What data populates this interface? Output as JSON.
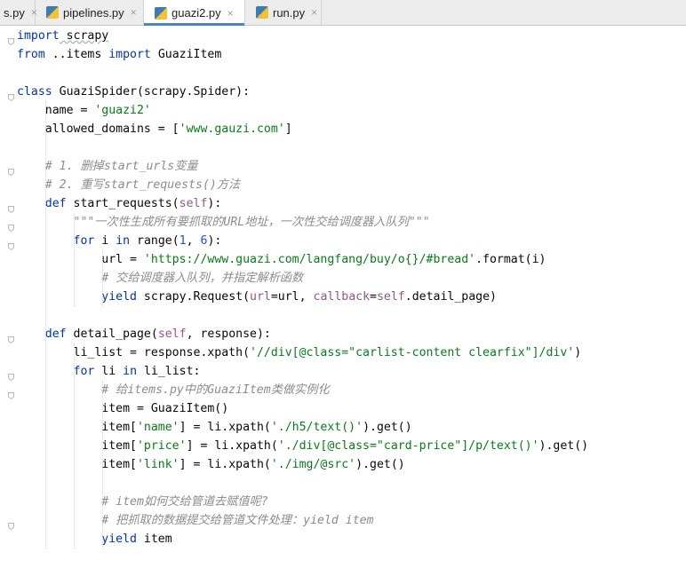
{
  "tabs": [
    {
      "label": "s.py",
      "active": false
    },
    {
      "label": "pipelines.py",
      "active": false
    },
    {
      "label": "guazi2.py",
      "active": true
    },
    {
      "label": "run.py",
      "active": false
    }
  ],
  "tab_close_glyph": "×",
  "code": [
    [
      {
        "t": "import",
        "c": "kw"
      },
      {
        "t": " scrapy"
      }
    ],
    [
      {
        "t": "from",
        "c": "kw"
      },
      {
        "t": " ..items "
      },
      {
        "t": "import",
        "c": "kw"
      },
      {
        "t": " GuaziItem"
      }
    ],
    [],
    [
      {
        "t": "class",
        "c": "kw"
      },
      {
        "t": " GuaziSpider(scrapy.Spider):"
      }
    ],
    [
      {
        "t": "    name = "
      },
      {
        "t": "'guazi2'",
        "c": "str"
      }
    ],
    [
      {
        "t": "    allowed_domains = ["
      },
      {
        "t": "'www.gauzi.com'",
        "c": "str"
      },
      {
        "t": "]"
      }
    ],
    [],
    [
      {
        "t": "    # 1. 删掉start_urls变量",
        "c": "cmt"
      }
    ],
    [
      {
        "t": "    # 2. 重写start_requests()方法",
        "c": "cmt"
      }
    ],
    [
      {
        "t": "    "
      },
      {
        "t": "def",
        "c": "kw"
      },
      {
        "t": " start_requests("
      },
      {
        "t": "self",
        "c": "slf"
      },
      {
        "t": "):"
      }
    ],
    [
      {
        "t": "        \"\"\"一次性生成所有要抓取的URL地址，一次性交给调度器入队列\"\"\"",
        "c": "cmt"
      }
    ],
    [
      {
        "t": "        "
      },
      {
        "t": "for",
        "c": "kw"
      },
      {
        "t": " i "
      },
      {
        "t": "in",
        "c": "kw"
      },
      {
        "t": " range("
      },
      {
        "t": "1",
        "c": "num"
      },
      {
        "t": ", "
      },
      {
        "t": "6",
        "c": "num"
      },
      {
        "t": "):"
      }
    ],
    [
      {
        "t": "            url = "
      },
      {
        "t": "'https://www.guazi.com/langfang/buy/o{}/#bread'",
        "c": "str"
      },
      {
        "t": ".format(i)"
      }
    ],
    [
      {
        "t": "            # 交给调度器入队列，并指定解析函数",
        "c": "cmt"
      }
    ],
    [
      {
        "t": "            "
      },
      {
        "t": "yield",
        "c": "kw"
      },
      {
        "t": " scrapy.Request("
      },
      {
        "t": "url",
        "c": "slf"
      },
      {
        "t": "=url, "
      },
      {
        "t": "callback",
        "c": "slf"
      },
      {
        "t": "="
      },
      {
        "t": "self",
        "c": "slf"
      },
      {
        "t": ".detail_page)"
      }
    ],
    [],
    [
      {
        "t": "    "
      },
      {
        "t": "def",
        "c": "kw"
      },
      {
        "t": " detail_page("
      },
      {
        "t": "self",
        "c": "slf"
      },
      {
        "t": ", response):"
      }
    ],
    [
      {
        "t": "        li_list = response.xpath("
      },
      {
        "t": "'//div[@class=\"carlist-content clearfix\"]/div'",
        "c": "str"
      },
      {
        "t": ")"
      }
    ],
    [
      {
        "t": "        "
      },
      {
        "t": "for",
        "c": "kw"
      },
      {
        "t": " li "
      },
      {
        "t": "in",
        "c": "kw"
      },
      {
        "t": " li_list:"
      }
    ],
    [
      {
        "t": "            # 给items.py中的GuaziItem类做实例化",
        "c": "cmt"
      }
    ],
    [
      {
        "t": "            item = GuaziItem()"
      }
    ],
    [
      {
        "t": "            item["
      },
      {
        "t": "'name'",
        "c": "str"
      },
      {
        "t": "] = li.xpath("
      },
      {
        "t": "'./h5/text()'",
        "c": "str"
      },
      {
        "t": ").get()"
      }
    ],
    [
      {
        "t": "            item["
      },
      {
        "t": "'price'",
        "c": "str"
      },
      {
        "t": "] = li.xpath("
      },
      {
        "t": "'./div[@class=\"card-price\"]/p/text()'",
        "c": "str"
      },
      {
        "t": ").get()"
      }
    ],
    [
      {
        "t": "            item["
      },
      {
        "t": "'link'",
        "c": "str"
      },
      {
        "t": "] = li.xpath("
      },
      {
        "t": "'./img/@src'",
        "c": "str"
      },
      {
        "t": ").get()"
      }
    ],
    [],
    [
      {
        "t": "            # item如何交给管道去赋值呢?",
        "c": "cmt"
      }
    ],
    [
      {
        "t": "            # 把抓取的数据提交给管道文件处理：yield item",
        "c": "cmt"
      }
    ],
    [
      {
        "t": "            "
      },
      {
        "t": "yield",
        "c": "kw"
      },
      {
        "t": " item"
      }
    ]
  ]
}
